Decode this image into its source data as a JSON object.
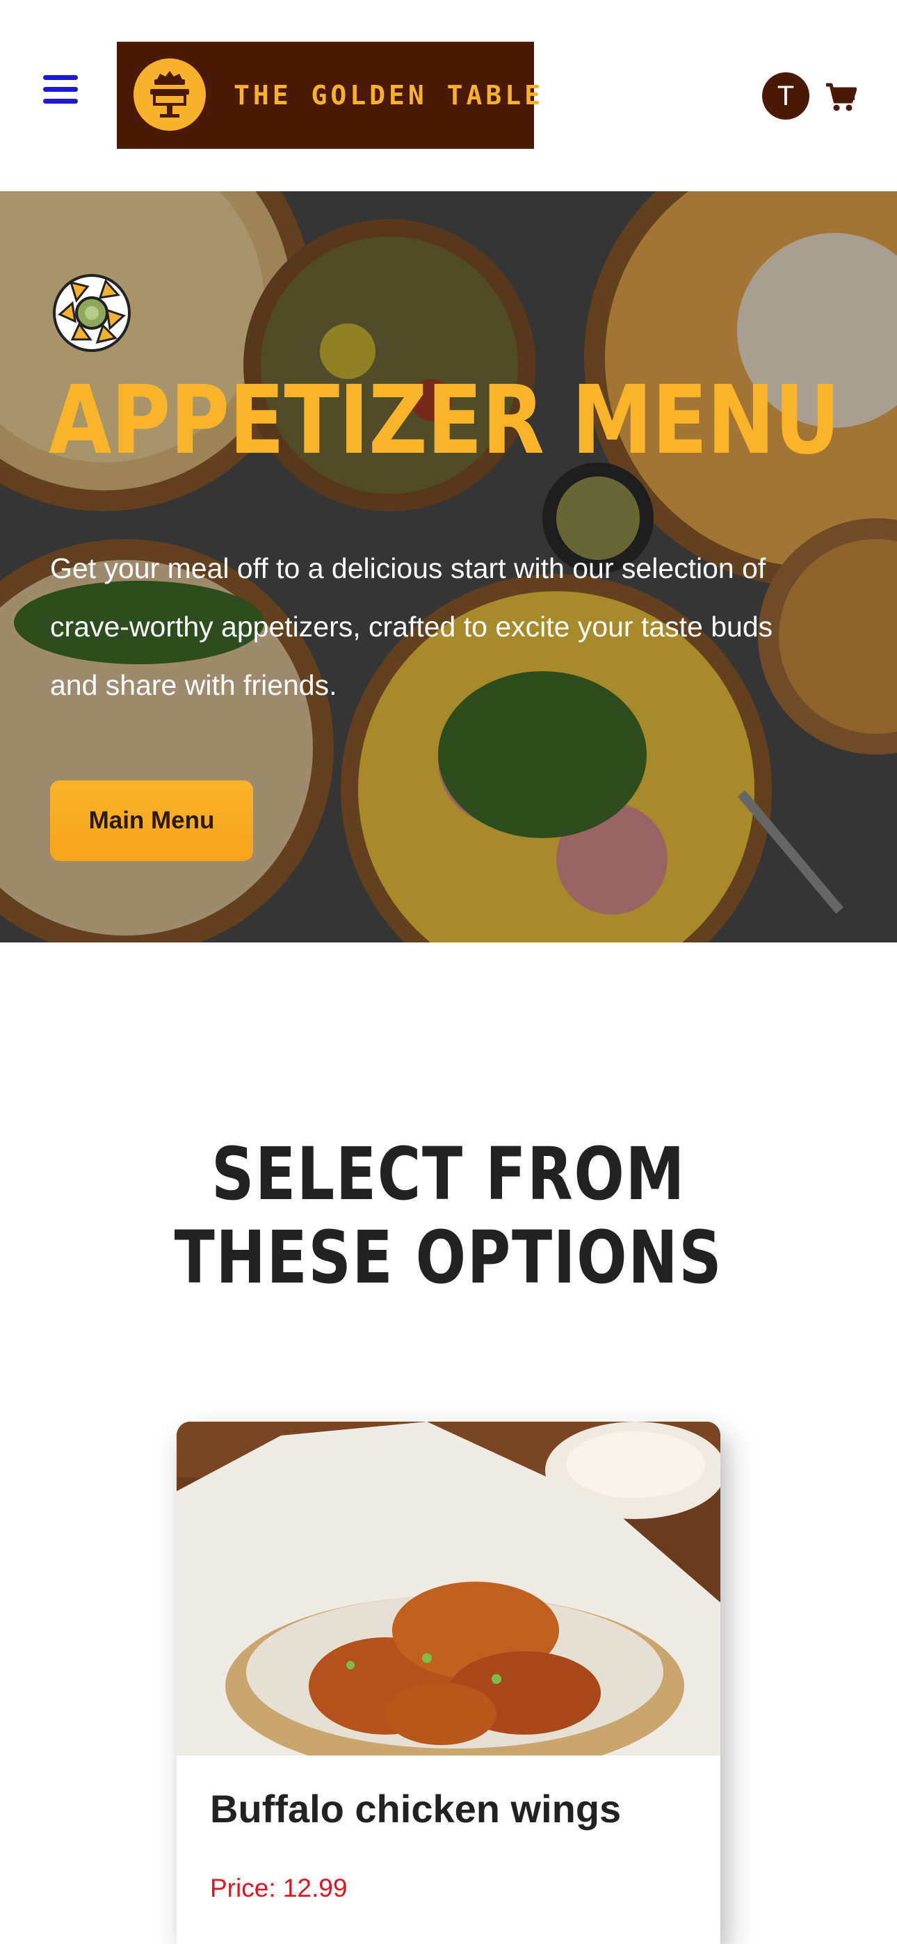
{
  "header": {
    "brand_name": "THE GOLDEN TABLE",
    "avatar_initial": "T",
    "icons": [
      "hamburger-menu-icon",
      "logo-table-icon",
      "cart-icon"
    ]
  },
  "hero": {
    "title": "APPETIZER MENU",
    "description": "Get your meal off to a delicious start with our selection of crave-worthy appetizers, crafted to excite your taste buds and share with friends.",
    "button_label": "Main Menu",
    "icon": "nachos-icon"
  },
  "options": {
    "title": "SELECT FROM THESE OPTIONS",
    "items": [
      {
        "name": "Buffalo chicken wings",
        "price": "Price: 12.99"
      }
    ]
  },
  "colors": {
    "brand_dark": "#4a1a07",
    "accent_gold": "#f9b42a",
    "menu_blue": "#1b1bd6",
    "price_red": "#e0141e",
    "heading": "#222222"
  }
}
